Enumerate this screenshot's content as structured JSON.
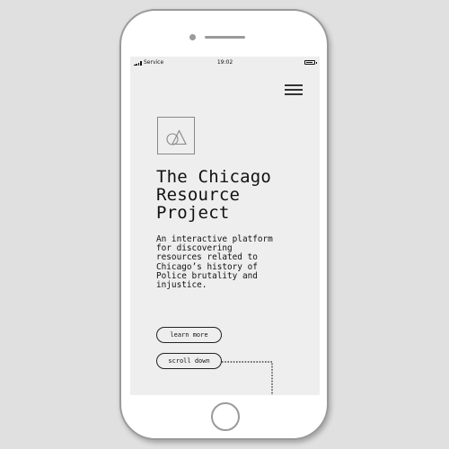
{
  "status_bar": {
    "carrier": "Service",
    "time": "19:02"
  },
  "hero": {
    "title": "The Chicago\nResource\nProject",
    "description": "An interactive platform\nfor discovering\nresources related to\nChicago’s history of\nPolice brutality and\ninjustice."
  },
  "actions": {
    "learn_more_label": "learn more",
    "scroll_down_label": "scroll down"
  },
  "colors": {
    "background": "#e0e0e0",
    "screen": "#eeeeee",
    "text": "#111111",
    "device_outline": "#9a9a9a"
  },
  "icons": {
    "menu": "hamburger-menu-icon",
    "logo": "circle-triangle-logo-icon",
    "signal": "signal-strength-icon",
    "battery": "battery-icon"
  }
}
